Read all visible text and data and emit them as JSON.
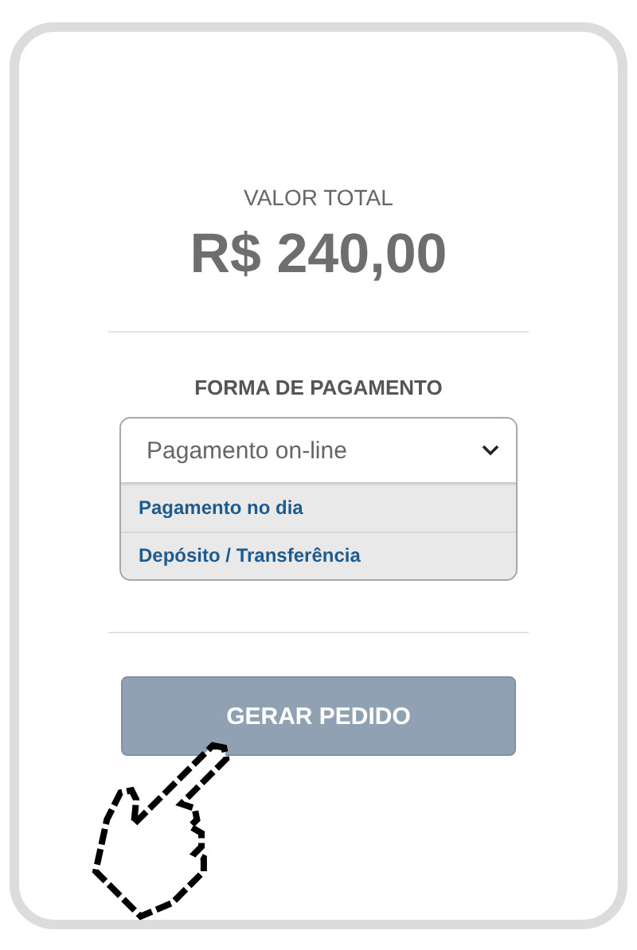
{
  "total": {
    "label": "VALOR TOTAL",
    "amount": "R$ 240,00"
  },
  "payment": {
    "heading": "FORMA DE PAGAMENTO",
    "value": "Pagamento on-line",
    "expanded": true,
    "options": [
      "Pagamento no dia",
      "Depósito / Transferência"
    ]
  },
  "submit_button": "GERAR PEDIDO"
}
